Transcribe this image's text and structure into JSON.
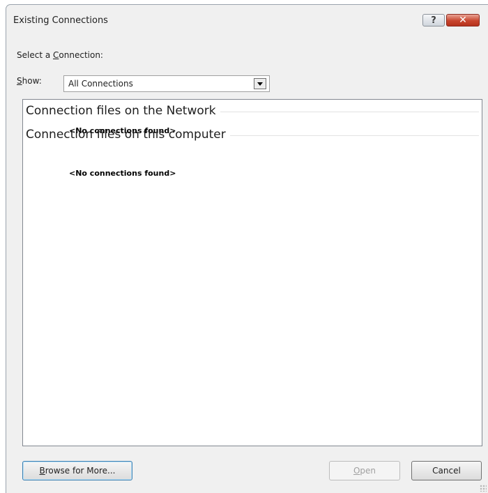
{
  "window": {
    "title": "Existing Connections",
    "help_label": "?",
    "close_label": "✕"
  },
  "select_connection": {
    "prefix": "Select a ",
    "accel": "C",
    "suffix": "onnection:"
  },
  "show": {
    "accel": "S",
    "suffix": "how:",
    "selected": "All Connections"
  },
  "groups": [
    {
      "header": "Connection files on the Network",
      "empty_text": "<No connections found>"
    },
    {
      "header": "Connection files on this computer",
      "empty_text": "<No connections found>"
    }
  ],
  "buttons": {
    "browse": {
      "accel": "B",
      "rest": "rowse for More..."
    },
    "open": {
      "accel": "O",
      "rest": "pen"
    },
    "cancel": "Cancel"
  }
}
